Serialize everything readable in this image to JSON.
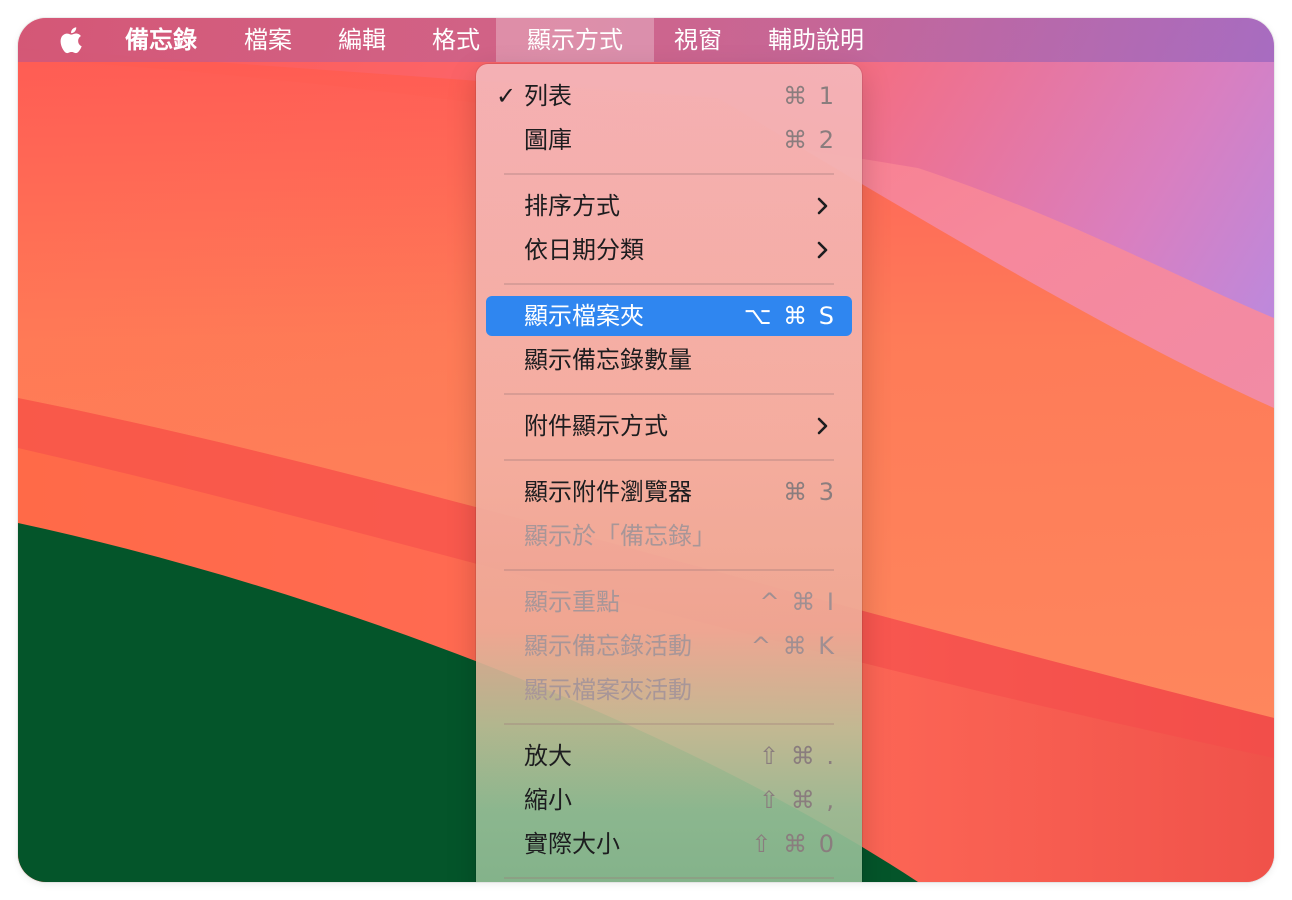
{
  "menubar": {
    "app_name": "備忘錄",
    "items": [
      "檔案",
      "編輯",
      "格式",
      "顯示方式",
      "視窗",
      "輔助說明"
    ]
  },
  "menu": {
    "groups": [
      [
        {
          "label": "列表",
          "shortcut": "⌘ 1",
          "checked": true
        },
        {
          "label": "圖庫",
          "shortcut": "⌘ 2"
        }
      ],
      [
        {
          "label": "排序方式",
          "submenu": true
        },
        {
          "label": "依日期分類",
          "submenu": true
        }
      ],
      [
        {
          "label": "顯示檔案夾",
          "shortcut": "⌥ ⌘ S",
          "selected": true
        },
        {
          "label": "顯示備忘錄數量"
        }
      ],
      [
        {
          "label": "附件顯示方式",
          "submenu": true
        }
      ],
      [
        {
          "label": "顯示附件瀏覽器",
          "shortcut": "⌘ 3"
        },
        {
          "label": "顯示於「備忘錄」",
          "disabled": true
        }
      ],
      [
        {
          "label": "顯示重點",
          "shortcut": "^ ⌘ I",
          "disabled": true
        },
        {
          "label": "顯示備忘錄活動",
          "shortcut": "^ ⌘ K",
          "disabled": true
        },
        {
          "label": "顯示檔案夾活動",
          "disabled": true
        }
      ],
      [
        {
          "label": "放大",
          "shortcut": "⇧ ⌘ ."
        },
        {
          "label": "縮小",
          "shortcut": "⇧ ⌘ ,"
        },
        {
          "label": "實際大小",
          "shortcut": "⇧ ⌘ 0"
        }
      ]
    ]
  },
  "colors": {
    "selection": "#2f86f0",
    "menu_text": "#1d1d1f",
    "disabled_text": "#a89698",
    "wallpaper_green": "#04552a",
    "wallpaper_red": "#f44a4a"
  }
}
